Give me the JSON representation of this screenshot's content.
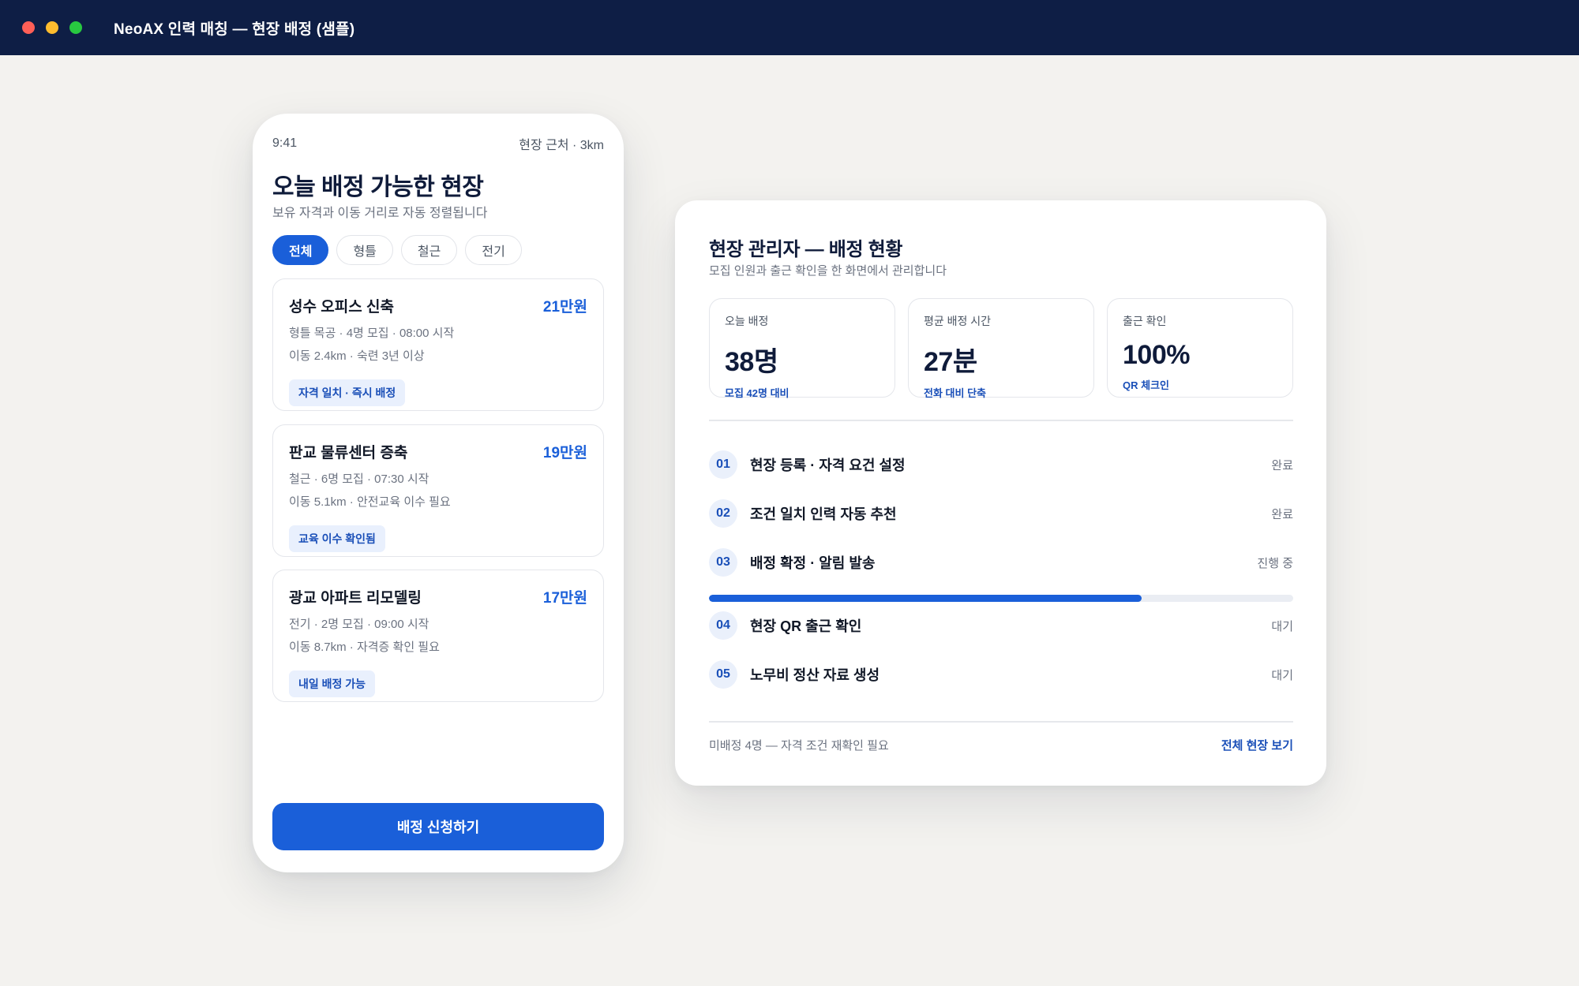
{
  "window": {
    "title": "NeoAX 인력 매칭 — 현장 배정 (샘플)",
    "controls": [
      "close",
      "minimize",
      "maximize"
    ]
  },
  "phone": {
    "status_time": "9:41",
    "status_location": "현장 근처 · 3km",
    "title": "오늘 배정 가능한 현장",
    "subtitle": "보유 자격과 이동 거리로 자동 정렬됩니다",
    "filters": [
      {
        "label": "전체",
        "active": true
      },
      {
        "label": "형틀",
        "active": false
      },
      {
        "label": "철근",
        "active": false
      },
      {
        "label": "전기",
        "active": false
      }
    ],
    "jobs": [
      {
        "name": "성수 오피스 신축",
        "pay": "21만원",
        "line1": "형틀 목공 · 4명 모집 · 08:00 시작",
        "line2": "이동 2.4km · 숙련 3년 이상",
        "tag": "자격 일치 · 즉시 배정"
      },
      {
        "name": "판교 물류센터 증축",
        "pay": "19만원",
        "line1": "철근 · 6명 모집 · 07:30 시작",
        "line2": "이동 5.1km · 안전교육 이수 필요",
        "tag": "교육 이수 확인됨"
      },
      {
        "name": "광교 아파트 리모델링",
        "pay": "17만원",
        "line1": "전기 · 2명 모집 · 09:00 시작",
        "line2": "이동 8.7km · 자격증 확인 필요",
        "tag": "내일 배정 가능"
      }
    ],
    "apply_button": "배정 신청하기"
  },
  "dashboard": {
    "title": "현장 관리자 — 배정 현황",
    "subtitle": "모집 인원과 출근 확인을 한 화면에서 관리합니다",
    "stats": [
      {
        "label": "오늘 배정",
        "value": "38명",
        "note": "모집 42명 대비"
      },
      {
        "label": "평균 배정 시간",
        "value": "27분",
        "note": "전화 대비 단축"
      },
      {
        "label": "출근 확인",
        "value": "100%",
        "note": "QR 체크인"
      }
    ],
    "steps": [
      {
        "num": "01",
        "label": "현장 등록 · 자격 요건 설정",
        "status": "완료"
      },
      {
        "num": "02",
        "label": "조건 일치 인력 자동 추천",
        "status": "완료"
      },
      {
        "num": "03",
        "label": "배정 확정 · 알림 발송",
        "status": "진행 중"
      },
      {
        "num": "04",
        "label": "현장 QR 출근 확인",
        "status": "대기"
      },
      {
        "num": "05",
        "label": "노무비 정산 자료 생성",
        "status": "대기"
      }
    ],
    "progress_fraction": 0.74,
    "footer_note": "미배정 4명 — 자격 조건 재확인 필요",
    "footer_link": "전체 현장 보기",
    "accent_color": "#1a5fd9"
  }
}
